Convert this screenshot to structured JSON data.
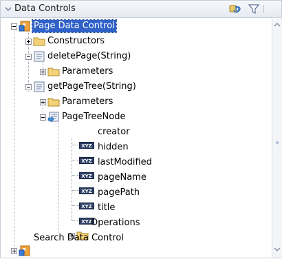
{
  "panel": {
    "title": "Data Controls",
    "tools": [
      "refresh-icon",
      "filter-icon"
    ]
  },
  "tree": {
    "root": "Page Data Control",
    "constructors": "Constructors",
    "deletePage": "deletePage(String)",
    "deletePage_params": "Parameters",
    "getPageTree": "getPageTree(String)",
    "getPageTree_params": "Parameters",
    "pageTreeNode": "PageTreeNode",
    "attributes": [
      "creator",
      "hidden",
      "lastModified",
      "pageName",
      "pagePath",
      "title"
    ],
    "operations": "Operations",
    "search": "Search Data Control"
  },
  "colors": {
    "selection": "#2f61c8",
    "folder": "#f4d27a",
    "header_bg": "#e6ebf2"
  }
}
